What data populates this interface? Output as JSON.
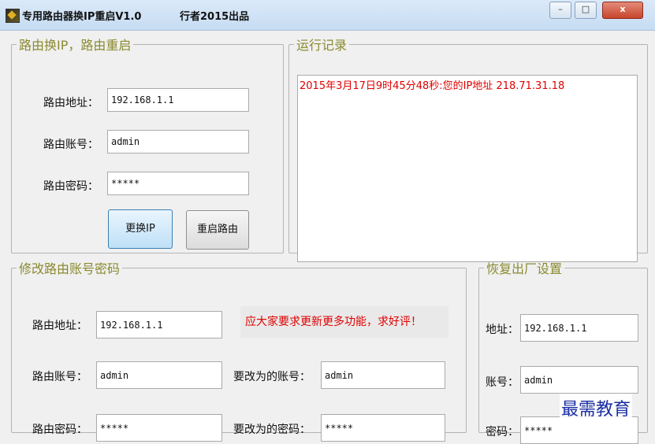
{
  "window": {
    "title": "专用路由器换IP重启V1.0",
    "author": "行者2015出品",
    "controls": {
      "minimize": "–",
      "maximize": "□",
      "close": "x"
    },
    "icon": "app-icon"
  },
  "router_group": {
    "legend": "路由换IP，路由重启",
    "address_label": "路由地址：",
    "address_value": "192.168.1.1",
    "account_label": "路由账号：",
    "account_value": "admin",
    "password_label": "路由密码：",
    "password_value": "*****",
    "change_ip_button": "更换IP",
    "restart_button": "重启路由"
  },
  "log_group": {
    "legend": "运行记录",
    "lines": [
      "2015年3月17日9时45分48秒:您的IP地址 218.71.31.18"
    ]
  },
  "change_account_group": {
    "legend": "修改路由账号密码",
    "address_label": "路由地址：",
    "address_value": "192.168.1.1",
    "notice": "应大家要求更新更多功能，求好评！",
    "account_label": "路由账号：",
    "account_value": "admin",
    "new_account_label": "要改为的账号：",
    "new_account_value": "admin",
    "password_label": "路由密码：",
    "password_value": "*****",
    "new_password_label": "要改为的密码：",
    "new_password_value": "*****"
  },
  "reset_group": {
    "legend": "恢复出厂设置",
    "address_label": "地址：",
    "address_value": "192.168.1.1",
    "account_label": "账号：",
    "account_value": "admin",
    "password_label": "密码：",
    "password_value": "*****"
  },
  "watermark": "最需教育",
  "colors": {
    "legend": "#8a8a30",
    "log_text": "#e00000",
    "notice_text": "#e00000",
    "watermark": "#1a2ea3"
  }
}
